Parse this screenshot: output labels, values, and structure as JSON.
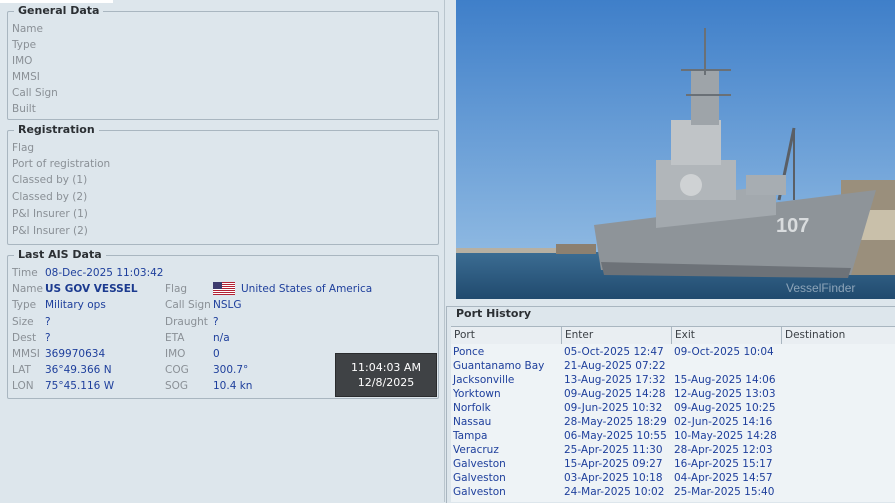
{
  "general": {
    "title": "General Data",
    "fields": [
      "Name",
      "Type",
      "IMO",
      "MMSI",
      "Call Sign",
      "Built"
    ]
  },
  "registration": {
    "title": "Registration",
    "fields": [
      "Flag",
      "Port of registration",
      "Classed by (1)",
      "Classed by (2)",
      "P&I Insurer (1)",
      "P&I Insurer (2)"
    ]
  },
  "ais": {
    "title": "Last AIS Data",
    "time_label": "Time",
    "time_value": "08-Dec-2025 11:03:42",
    "name_label": "Name",
    "name_value": "US GOV VESSEL",
    "type_label": "Type",
    "type_value": "Military ops",
    "size_label": "Size",
    "size_value": "?",
    "dest_label": "Dest",
    "dest_value": "?",
    "mmsi_label": "MMSI",
    "mmsi_value": "369970634",
    "lat_label": "LAT",
    "lat_value": "36°49.366 N",
    "lon_label": "LON",
    "lon_value": "75°45.116 W",
    "flag_label": "Flag",
    "flag_value": "United States of America",
    "callsign_label": "Call Sign",
    "callsign_value": "NSLG",
    "draught_label": "Draught",
    "draught_value": "?",
    "eta_label": "ETA",
    "eta_value": "n/a",
    "imo_label": "IMO",
    "imo_value": "0",
    "cog_label": "COG",
    "cog_value": "300.7°",
    "sog_label": "SOG",
    "sog_value": "10.4 kn"
  },
  "clock": {
    "time": "11:04:03 AM",
    "date": "12/8/2025"
  },
  "photo": {
    "hull_number": "107",
    "watermark": "VesselFinder"
  },
  "history": {
    "title": "Port History",
    "columns": [
      "Port",
      "Enter",
      "Exit",
      "Destination"
    ],
    "rows": [
      [
        "Ponce",
        "05-Oct-2025 12:47",
        "09-Oct-2025 10:04",
        ""
      ],
      [
        "Guantanamo Bay",
        "21-Aug-2025 07:22",
        "",
        ""
      ],
      [
        "Jacksonville",
        "13-Aug-2025 17:32",
        "15-Aug-2025 14:06",
        ""
      ],
      [
        "Yorktown",
        "09-Aug-2025 14:28",
        "12-Aug-2025 13:03",
        ""
      ],
      [
        "Norfolk",
        "09-Jun-2025 10:32",
        "09-Aug-2025 10:25",
        ""
      ],
      [
        "Nassau",
        "28-May-2025 18:29",
        "02-Jun-2025 14:16",
        ""
      ],
      [
        "Tampa",
        "06-May-2025 10:55",
        "10-May-2025 14:28",
        ""
      ],
      [
        "Veracruz",
        "25-Apr-2025 11:30",
        "28-Apr-2025 12:03",
        ""
      ],
      [
        "Galveston",
        "15-Apr-2025 09:27",
        "16-Apr-2025 15:17",
        ""
      ],
      [
        "Galveston",
        "03-Apr-2025 10:18",
        "04-Apr-2025 14:57",
        ""
      ],
      [
        "Galveston",
        "24-Mar-2025 10:02",
        "25-Mar-2025 15:40",
        ""
      ]
    ]
  }
}
